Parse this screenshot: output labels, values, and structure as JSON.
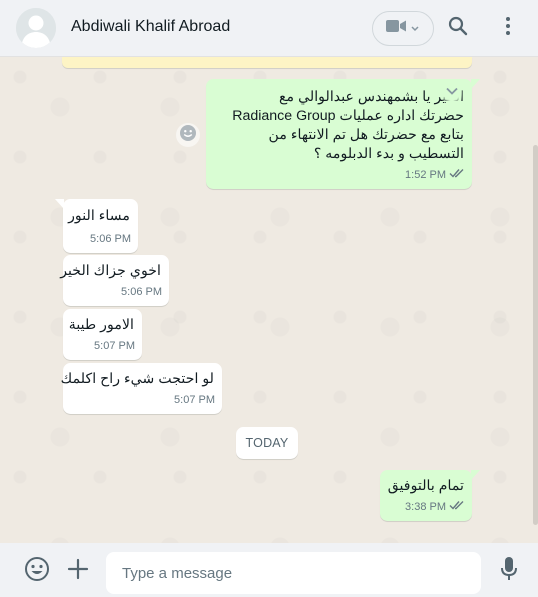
{
  "header": {
    "contact_name": "Abdiwali Khalif Abroad",
    "icons": {
      "avatar": "default-avatar",
      "video": "video-camera-icon",
      "dropdown": "chevron-down-icon",
      "search": "search-icon",
      "menu": "kebab-menu-icon"
    }
  },
  "messages": [
    {
      "direction": "outgoing",
      "lines": [
        "الخير يا بشمهندس عبدالوالي  مع",
        "حضرتك اداره عمليات Radiance Group",
        "بتابع مع حضرتك هل تم الانتهاء من",
        "التسطيب و بدء الدبلومه ؟"
      ],
      "time": "1:52 PM",
      "status": "read"
    },
    {
      "direction": "incoming",
      "text": "مساء النور",
      "time": "5:06 PM"
    },
    {
      "direction": "incoming",
      "text": "اخوي جزاك الخير",
      "time": "5:06 PM"
    },
    {
      "direction": "incoming",
      "text": "الامور طيبة",
      "time": "5:07 PM"
    },
    {
      "direction": "incoming",
      "text": "لو احتجت شيء راح اكلمك",
      "time": "5:07 PM"
    },
    {
      "direction": "outgoing",
      "text": "تمام بالتوفيق",
      "time": "3:38 PM",
      "status": "read"
    }
  ],
  "date_divider": "TODAY",
  "composer": {
    "placeholder": "Type a message",
    "icons": {
      "emoji": "emoji-icon",
      "attach": "plus-icon",
      "mic": "microphone-icon"
    }
  },
  "colors": {
    "outgoing_bubble": "#d9fdd3",
    "incoming_bubble": "#ffffff",
    "read_ticks": "#667781",
    "chat_background": "#efeae2"
  }
}
